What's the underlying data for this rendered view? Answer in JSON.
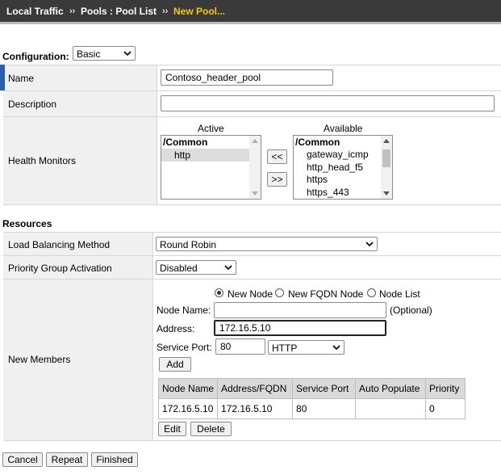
{
  "breadcrumb": {
    "items": [
      "Local Traffic",
      "Pools : Pool List",
      "New Pool..."
    ],
    "separator": "››"
  },
  "configuration": {
    "label": "Configuration:",
    "mode": "Basic"
  },
  "general": {
    "name_label": "Name",
    "name_value": "Contoso_header_pool",
    "description_label": "Description",
    "description_value": "",
    "health_monitors_label": "Health Monitors",
    "active_header": "Active",
    "available_header": "Available",
    "active_items": [
      "/Common",
      "http"
    ],
    "available_items": [
      "/Common",
      "gateway_icmp",
      "http_head_f5",
      "https",
      "https_443"
    ],
    "move_left": "<<",
    "move_right": ">>"
  },
  "resources": {
    "section_title": "Resources",
    "lb_method_label": "Load Balancing Method",
    "lb_method_value": "Round Robin",
    "priority_group_label": "Priority Group Activation",
    "priority_group_value": "Disabled",
    "new_members_label": "New Members",
    "radio_options": [
      "New Node",
      "New FQDN Node",
      "Node List"
    ],
    "radio_selected": "New Node",
    "node_name_label": "Node Name:",
    "node_name_value": "",
    "optional_text": "(Optional)",
    "address_label": "Address:",
    "address_value": "172.16.5.10",
    "service_port_label": "Service Port:",
    "service_port_value": "80",
    "service_port_protocol": "HTTP",
    "add_button": "Add",
    "table_headers": [
      "Node Name",
      "Address/FQDN",
      "Service Port",
      "Auto Populate",
      "Priority"
    ],
    "table_rows": [
      [
        "172.16.5.10",
        "172.16.5.10",
        "80",
        "",
        "0"
      ]
    ],
    "edit_button": "Edit",
    "delete_button": "Delete"
  },
  "footer": {
    "cancel": "Cancel",
    "repeat": "Repeat",
    "finished": "Finished"
  }
}
